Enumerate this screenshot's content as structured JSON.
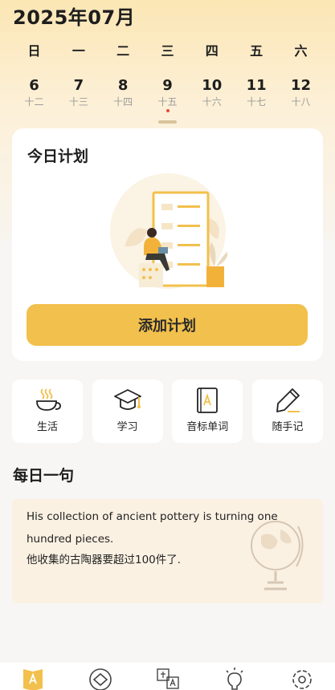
{
  "calendar": {
    "month_title": "2025年07月",
    "weekdays": [
      "日",
      "一",
      "二",
      "三",
      "四",
      "五",
      "六"
    ],
    "days": [
      {
        "num": "6",
        "lunar": "十二"
      },
      {
        "num": "7",
        "lunar": "十三"
      },
      {
        "num": "8",
        "lunar": "十四"
      },
      {
        "num": "9",
        "lunar": "十五"
      },
      {
        "num": "10",
        "lunar": "十六"
      },
      {
        "num": "11",
        "lunar": "十七"
      },
      {
        "num": "12",
        "lunar": "十八"
      }
    ],
    "selected_day": "9"
  },
  "plan": {
    "title": "今日计划",
    "add_button": "添加计划"
  },
  "tools": [
    {
      "label": "生活",
      "icon": "coffee-cup-icon"
    },
    {
      "label": "学习",
      "icon": "graduation-cap-icon"
    },
    {
      "label": "音标单词",
      "icon": "phonetic-book-icon"
    },
    {
      "label": "随手记",
      "icon": "pencil-icon"
    }
  ],
  "daily_sentence": {
    "title": "每日一句",
    "english": "His collection of ancient pottery is turning one hundred pieces.",
    "chinese": "他收集的古陶器要超过100件了."
  },
  "tabbar": [
    {
      "icon": "letter-a-book-icon",
      "active": true
    },
    {
      "icon": "tag-icon",
      "active": false
    },
    {
      "icon": "translate-icon",
      "active": false
    },
    {
      "icon": "lightbulb-icon",
      "active": false
    },
    {
      "icon": "settings-gear-icon",
      "active": false
    }
  ],
  "colors": {
    "accent": "#f2c04c",
    "header_gradient_top": "#fbe6b4",
    "background": "#f7f6f4",
    "quote_bg": "#faf1e3",
    "today_dot": "#e84a3c"
  }
}
